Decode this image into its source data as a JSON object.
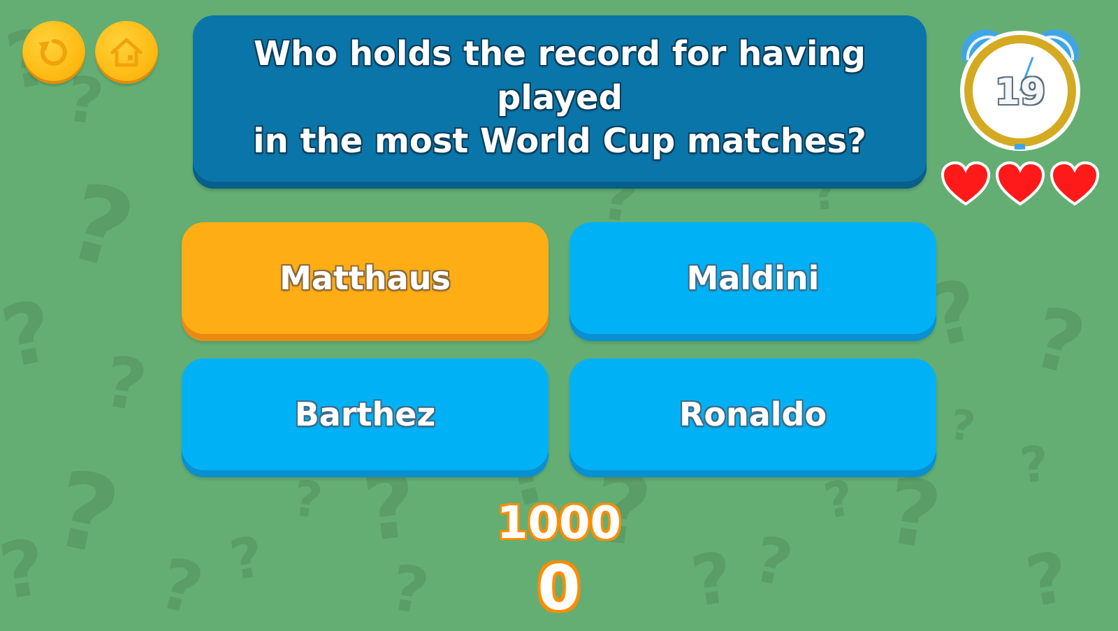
{
  "question": {
    "line1": "Who holds the record for having played",
    "line2": "in the most World Cup matches?"
  },
  "answers": [
    {
      "label": "Matthaus",
      "state": "selected",
      "color": "#ffad14"
    },
    {
      "label": "Maldini",
      "state": "default",
      "color": "#00b2f5"
    },
    {
      "label": "Barthez",
      "state": "default",
      "color": "#00b2f5"
    },
    {
      "label": "Ronaldo",
      "state": "default",
      "color": "#00b2f5"
    }
  ],
  "timer": {
    "value": "19"
  },
  "lives": {
    "count": 3,
    "max": 3
  },
  "score": {
    "target": "1000",
    "current": "0"
  },
  "buttons": {
    "restart_icon": "restart-icon",
    "home_icon": "home-icon"
  },
  "background": {
    "color": "#64ae73",
    "pattern_glyph": "?"
  }
}
